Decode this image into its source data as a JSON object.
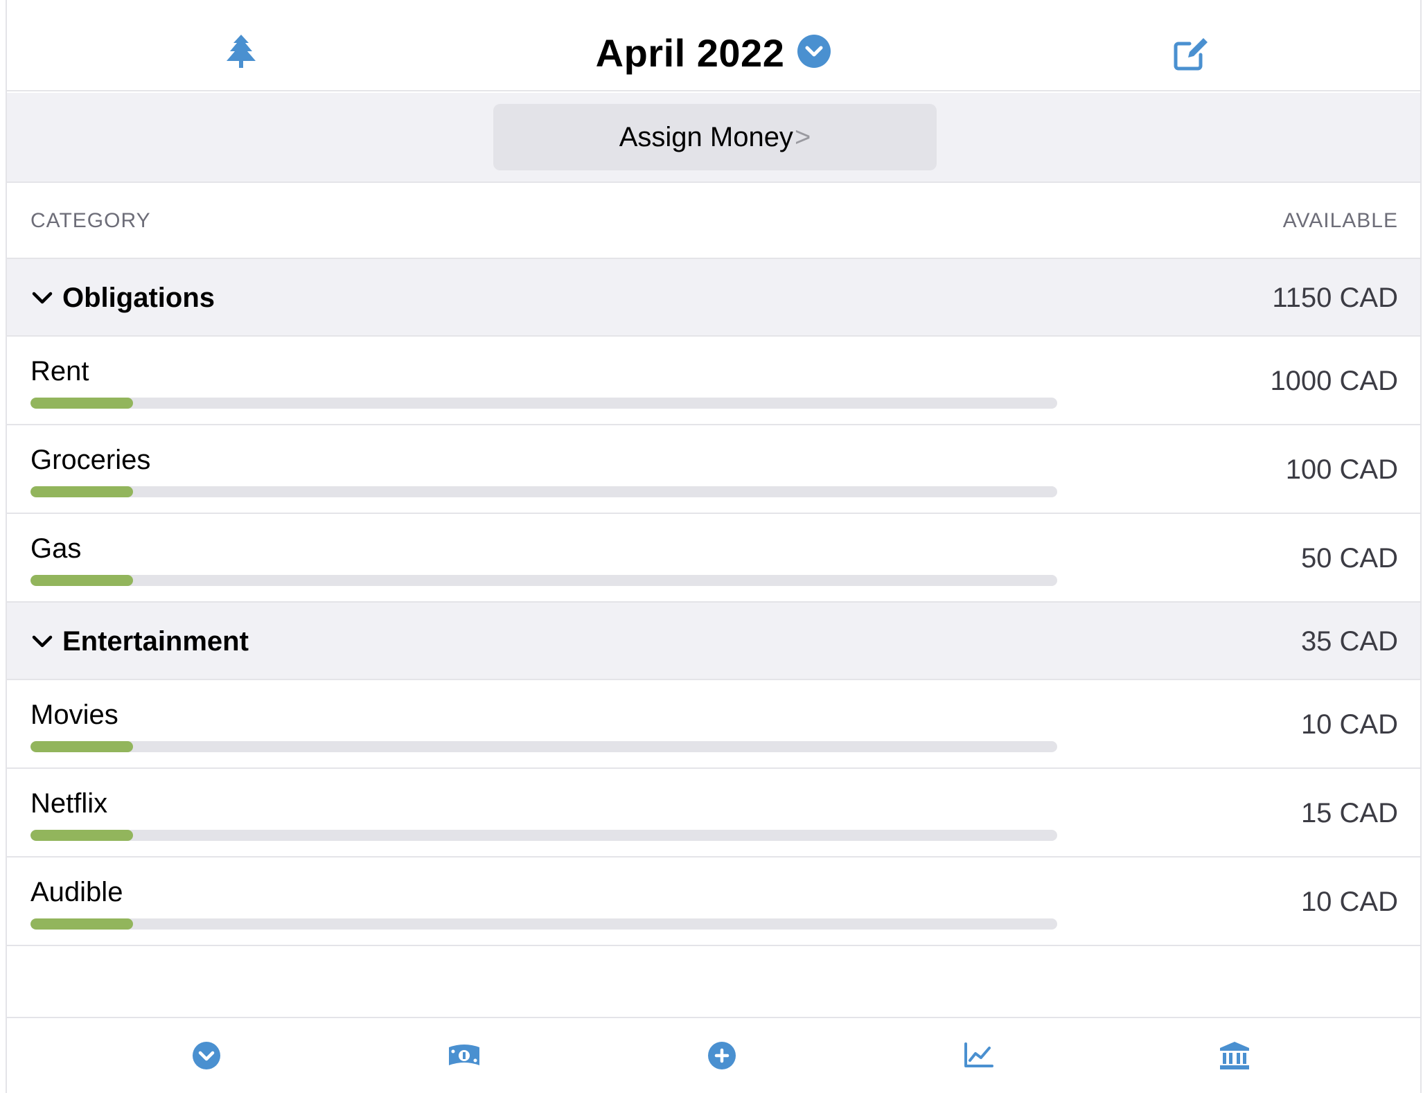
{
  "header": {
    "title": "April 2022",
    "left_icon": "tree-icon",
    "title_icon": "chevron-down-circle-icon",
    "right_icon": "edit-icon"
  },
  "assign": {
    "label": "Assign Money",
    "chevron": ">"
  },
  "columns": {
    "category": "CATEGORY",
    "available": "AVAILABLE"
  },
  "groups": [
    {
      "name": "Obligations",
      "amount": "1150 CAD",
      "categories": [
        {
          "name": "Rent",
          "amount": "1000 CAD",
          "progress": 0.1
        },
        {
          "name": "Groceries",
          "amount": "100 CAD",
          "progress": 0.1
        },
        {
          "name": "Gas",
          "amount": "50 CAD",
          "progress": 0.1
        }
      ]
    },
    {
      "name": "Entertainment",
      "amount": "35 CAD",
      "categories": [
        {
          "name": "Movies",
          "amount": "10 CAD",
          "progress": 0.1
        },
        {
          "name": "Netflix",
          "amount": "15 CAD",
          "progress": 0.1
        },
        {
          "name": "Audible",
          "amount": "10 CAD",
          "progress": 0.1
        }
      ]
    }
  ],
  "tabbar": {
    "tabs": [
      {
        "icon": "chevron-down-circle-icon"
      },
      {
        "icon": "money-bill-icon"
      },
      {
        "icon": "plus-circle-icon"
      },
      {
        "icon": "line-chart-icon"
      },
      {
        "icon": "bank-icon"
      }
    ]
  },
  "colors": {
    "accent": "#4a90d0",
    "progress_fill": "#92b55c",
    "progress_track": "#e3e3e8",
    "group_bg": "#f1f1f5"
  }
}
